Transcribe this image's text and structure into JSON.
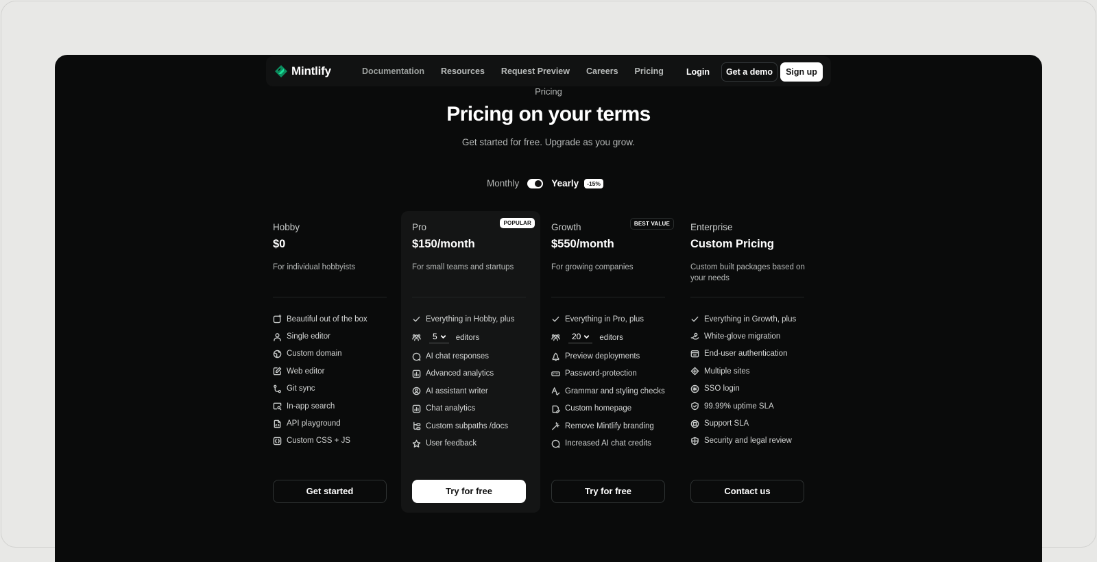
{
  "brand": {
    "name": "Mintlify",
    "accent": "#18e299"
  },
  "nav": {
    "links": [
      "Documentation",
      "Resources",
      "Request Preview",
      "Careers",
      "Pricing"
    ],
    "login": "Login",
    "demo": "Get a demo",
    "signup": "Sign up"
  },
  "header": {
    "eyebrow": "Pricing",
    "title": "Pricing on your terms",
    "subtitle": "Get started for free. Upgrade as you grow."
  },
  "billing": {
    "monthly": "Monthly",
    "yearly": "Yearly",
    "discount": "-15%",
    "selected": "yearly"
  },
  "plans": [
    {
      "name": "Hobby",
      "price": "$0",
      "description": "For individual hobbyists",
      "badge": "",
      "features": [
        {
          "icon": "sparkle-box-icon",
          "text": "Beautiful out of the box"
        },
        {
          "icon": "user-icon",
          "text": "Single editor"
        },
        {
          "icon": "globe-icon",
          "text": "Custom domain"
        },
        {
          "icon": "pencil-icon",
          "text": "Web editor"
        },
        {
          "icon": "git-branch-icon",
          "text": "Git sync"
        },
        {
          "icon": "search-window-icon",
          "text": "In-app search"
        },
        {
          "icon": "file-code-icon",
          "text": "API playground"
        },
        {
          "icon": "braces-icon",
          "text": "Custom CSS + JS"
        }
      ],
      "cta": "Get started"
    },
    {
      "name": "Pro",
      "price": "$150/month",
      "description": "For small teams and startups",
      "badge": "POPULAR",
      "intro": "Everything in Hobby, plus",
      "editors": {
        "value": "5",
        "suffix": "editors"
      },
      "features": [
        {
          "icon": "chat-sparkle-icon",
          "text": "AI chat responses"
        },
        {
          "icon": "analytics-icon",
          "text": "Advanced analytics"
        },
        {
          "icon": "bot-icon",
          "text": "AI assistant writer"
        },
        {
          "icon": "chart-icon",
          "text": "Chat analytics"
        },
        {
          "icon": "folder-tree-icon",
          "text": "Custom subpaths /docs"
        },
        {
          "icon": "star-icon",
          "text": "User feedback"
        }
      ],
      "cta": "Try for free"
    },
    {
      "name": "Growth",
      "price": "$550/month",
      "description": "For growing companies",
      "badge": "BEST VALUE",
      "intro": "Everything in Pro, plus",
      "editors": {
        "value": "20",
        "suffix": "editors"
      },
      "features": [
        {
          "icon": "rocket-icon",
          "text": "Preview deployments"
        },
        {
          "icon": "password-icon",
          "text": "Password-protection"
        },
        {
          "icon": "spell-check-icon",
          "text": "Grammar and styling checks"
        },
        {
          "icon": "home-edit-icon",
          "text": "Custom homepage"
        },
        {
          "icon": "wand-icon",
          "text": "Remove Mintlify branding"
        },
        {
          "icon": "chat-plus-icon",
          "text": "Increased AI chat credits"
        }
      ],
      "cta": "Try for free"
    },
    {
      "name": "Enterprise",
      "price": "Custom Pricing",
      "description": "Custom built packages based on your needs",
      "badge": "",
      "intro": "Everything in Growth, plus",
      "features": [
        {
          "icon": "hand-icon",
          "text": "White-glove migration"
        },
        {
          "icon": "browser-lock-icon",
          "text": "End-user authentication"
        },
        {
          "icon": "sites-icon",
          "text": "Multiple sites"
        },
        {
          "icon": "sso-icon",
          "text": "SSO login"
        },
        {
          "icon": "shield-check-icon",
          "text": "99.99% uptime SLA"
        },
        {
          "icon": "lifebuoy-icon",
          "text": "Support SLA"
        },
        {
          "icon": "shield-icon",
          "text": "Security and legal review"
        }
      ],
      "cta": "Contact us"
    }
  ]
}
